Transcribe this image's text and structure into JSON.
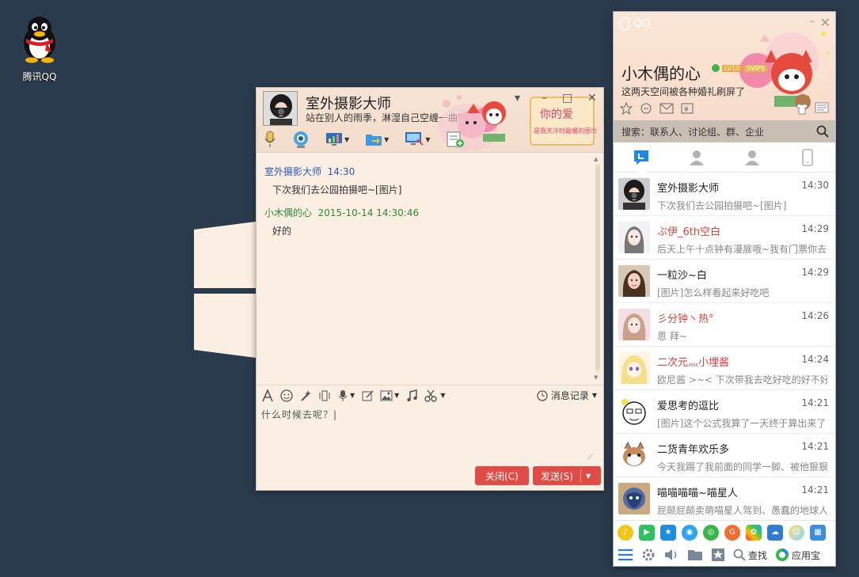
{
  "desktop": {
    "qq_icon_label": "腾讯QQ"
  },
  "chat_window": {
    "contact_name": "室外摄影大师",
    "contact_signature": "站在别人的雨季，淋湿自己空缠一曲欢...",
    "banner_text_1": "你的爱",
    "banner_text_2": "是我天冷时最暖的围巾",
    "messages": [
      {
        "sender": "室外摄影大师",
        "time": "14:30",
        "text": "下次我们去公园拍摄吧~[图片]"
      },
      {
        "sender": "小木偶的心",
        "time": "2015-10-14 14:30:46",
        "text": "好的"
      }
    ],
    "history_label": "消息记录",
    "input_text": "什么时候去呢？|",
    "close_button": "关闭(C)",
    "send_button": "发送(S)"
  },
  "qq_panel": {
    "logo_text": "QQ",
    "nickname": "小木偶的心",
    "signature": "这两天空间被各种婚礼刷屏了",
    "level_badge": "LV10",
    "svip_badge": "SVIP5",
    "search_placeholder": "搜索：联系人、讨论组、群、企业",
    "conversations": [
      {
        "name": "室外摄影大师",
        "time": "14:30",
        "preview": "下次我们去公园拍摄吧~[图片]",
        "red": false
      },
      {
        "name": "ぷ伊_6th空白",
        "time": "14:29",
        "preview": "后天上午十点钟有漫展哦~我有门票你去",
        "red": true
      },
      {
        "name": "一粒沙~白",
        "time": "14:29",
        "preview": "[图片]怎么样看起来好吃吧",
        "red": false
      },
      {
        "name": "彡分钟丶热°",
        "time": "14:26",
        "preview": "恩 拜~",
        "red": true
      },
      {
        "name": "二次元灬小埋酱",
        "time": "14:24",
        "preview": "欧尼酱 >~< 下次带我去吃好吃的好不好",
        "red": true
      },
      {
        "name": "爱思考的逗比",
        "time": "14:21",
        "preview": "[图片]这个公式我算了一天终于算出来了",
        "red": false
      },
      {
        "name": "二货青年欢乐多",
        "time": "14:21",
        "preview": "今天我踢了我前面的同学一脚、被他狠狠",
        "red": false
      },
      {
        "name": "喵喵喵喵~喵星人",
        "time": "14:21",
        "preview": "屁颠屁颠卖萌喵星人驾到、愚蠢的地球人",
        "red": false
      }
    ],
    "find_label": "查找",
    "appstore_label": "应用宝"
  }
}
